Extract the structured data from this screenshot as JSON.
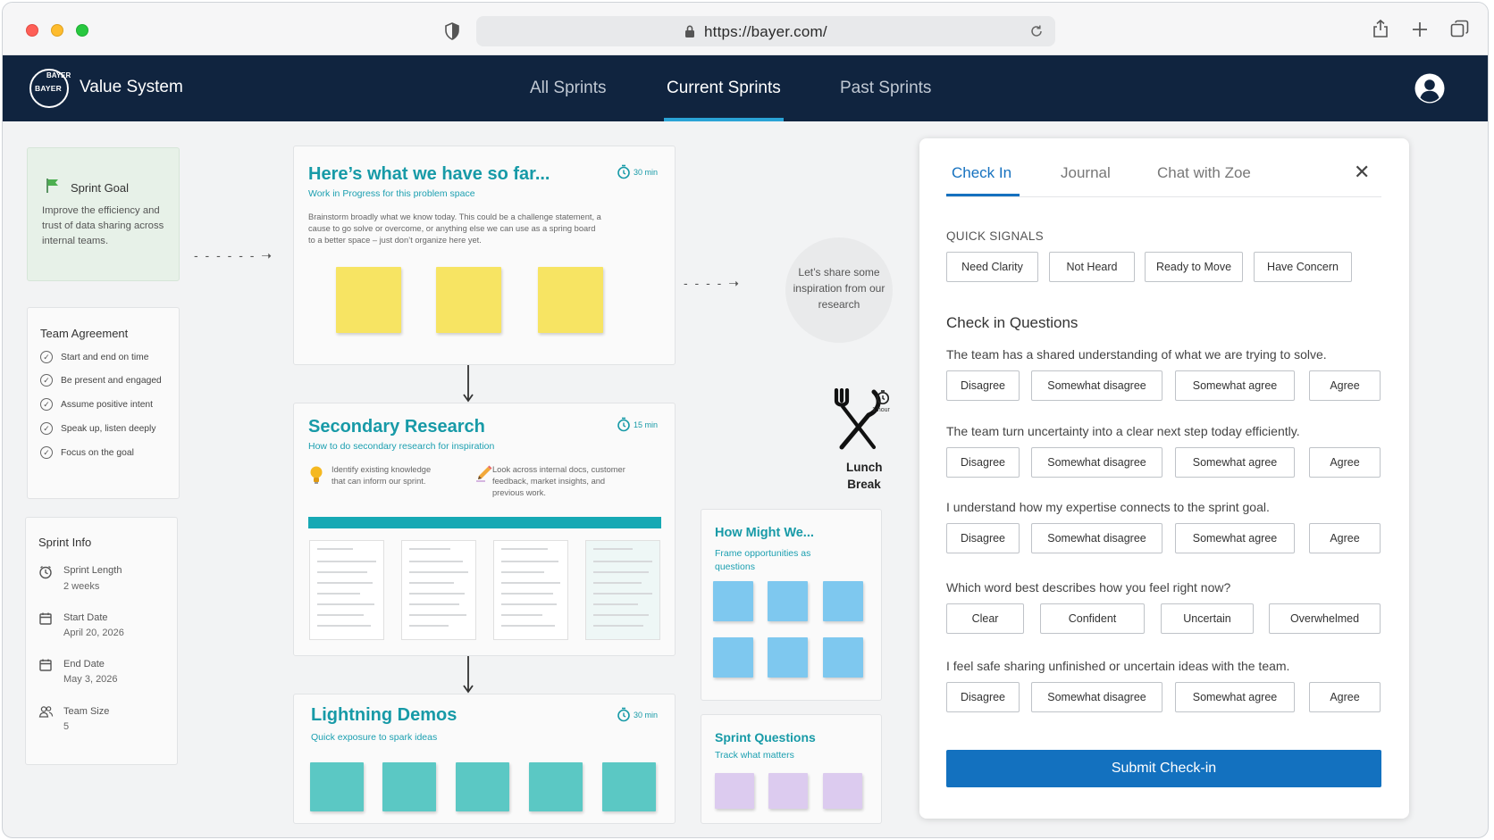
{
  "browser": {
    "url": "https://bayer.com/"
  },
  "navbar": {
    "logo_text_horizontal": "BAYER",
    "logo_text_vertical": "BAYER",
    "brand": "Value System",
    "tabs": [
      {
        "label": "All Sprints",
        "active": false
      },
      {
        "label": "Current Sprints",
        "active": true
      },
      {
        "label": "Past Sprints",
        "active": false
      }
    ],
    "accent_color": "#2aa3d6",
    "bg_color": "#10243f"
  },
  "sidebar": {
    "goal": {
      "title": "Sprint Goal",
      "text": "Improve the efficiency and trust of data sharing across internal teams."
    },
    "agreement": {
      "title": "Team Agreement",
      "items": [
        "Start and end on time",
        "Be present and engaged",
        "Assume positive intent",
        "Speak up, listen deeply",
        "Focus on the goal"
      ]
    },
    "info": {
      "title": "Sprint Info",
      "items": [
        {
          "icon": "clock-icon",
          "label": "Sprint Length",
          "value": "2 weeks"
        },
        {
          "icon": "calendar-icon",
          "label": "Start Date",
          "value": "April 20, 2026"
        },
        {
          "icon": "calendar-icon",
          "label": "End Date",
          "value": "May 3, 2026"
        },
        {
          "icon": "people-icon",
          "label": "Team Size",
          "value": "5"
        }
      ]
    }
  },
  "board": {
    "so_far": {
      "title": "Here’s what we have so far...",
      "subtitle": "Work in Progress for this problem space",
      "timer": "30 min",
      "body": "Brainstorm broadly what we know today. This could be a challenge statement, a cause to go solve or overcome, or anything else we can use as a spring board to a better space – just don’t organize here yet."
    },
    "secondary": {
      "title": "Secondary Research",
      "subtitle": "How to do secondary research for inspiration",
      "timer": "15 min",
      "tip1": "Identify existing knowledge that can inform our sprint.",
      "tip2": "Look across internal docs, customer feedback, market insights, and previous work."
    },
    "lightning": {
      "title": "Lightning Demos",
      "subtitle": "Quick exposure to spark ideas",
      "timer": "30 min"
    },
    "inspiration_bubble": "Let’s share some inspiration from our research",
    "lunch": {
      "timer": "1 hour",
      "label_line1": "Lunch",
      "label_line2": "Break"
    },
    "hmw": {
      "title": "How Might We...",
      "subtitle": "Frame opportunities as questions"
    },
    "questions": {
      "title": "Sprint Questions",
      "subtitle": "Track what matters"
    }
  },
  "panel": {
    "tabs": [
      {
        "label": "Check In",
        "active": true
      },
      {
        "label": "Journal",
        "active": false
      },
      {
        "label": "Chat with Zoe",
        "active": false
      }
    ],
    "quick_signals_label": "QUICK SIGNALS",
    "quick_signals": [
      "Need Clarity",
      "Not Heard",
      "Ready to Move",
      "Have Concern"
    ],
    "questions_title": "Check in Questions",
    "questions": [
      {
        "text": "The team has a shared understanding of what we are trying to solve.",
        "options": [
          "Disagree",
          "Somewhat disagree",
          "Somewhat agree",
          "Agree"
        ]
      },
      {
        "text": "The team turn uncertainty into a clear next step today efficiently.",
        "options": [
          "Disagree",
          "Somewhat disagree",
          "Somewhat agree",
          "Agree"
        ]
      },
      {
        "text": "I understand how my expertise connects to the sprint goal.",
        "options": [
          "Disagree",
          "Somewhat disagree",
          "Somewhat agree",
          "Agree"
        ]
      },
      {
        "text": "Which word best describes how you feel right now?",
        "options": [
          "Clear",
          "Confident",
          "Uncertain",
          "Overwhelmed"
        ]
      },
      {
        "text": "I feel safe sharing unfinished or uncertain ideas with the team.",
        "options": [
          "Disagree",
          "Somewhat disagree",
          "Somewhat agree",
          "Agree"
        ]
      }
    ],
    "submit_label": "Submit Check-in",
    "primary_color": "#1371bf"
  }
}
